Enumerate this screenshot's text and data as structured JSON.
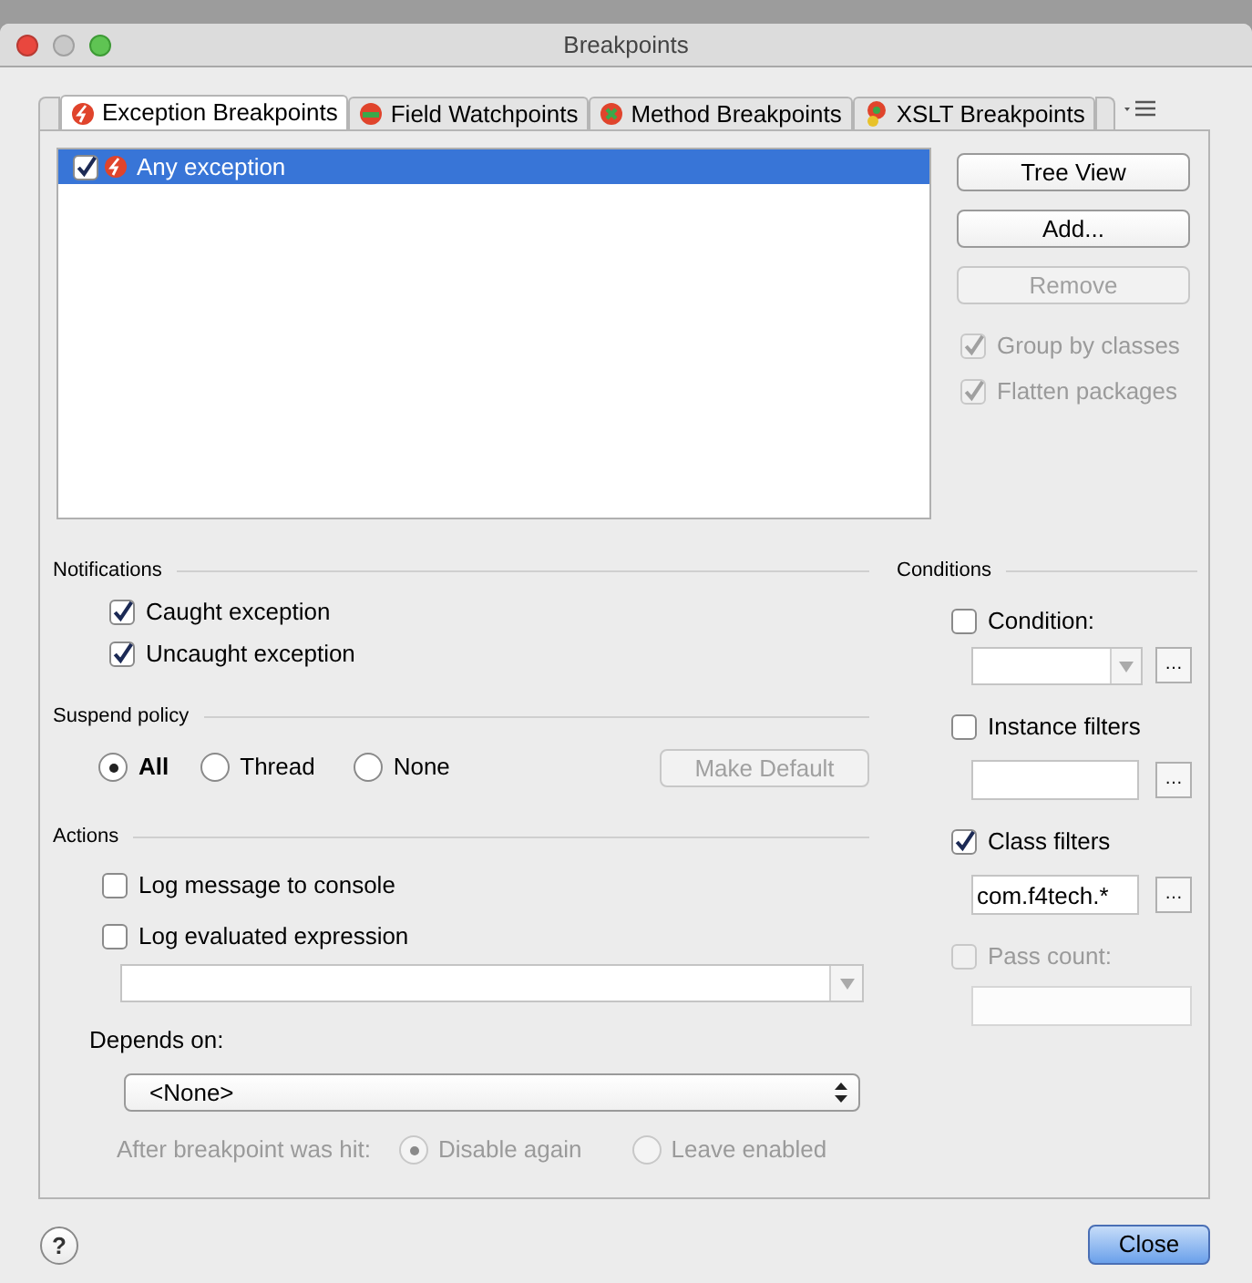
{
  "window": {
    "title": "Breakpoints"
  },
  "tabs": [
    {
      "label": "Exception Breakpoints",
      "selected": true,
      "kind": "exception"
    },
    {
      "label": "Field Watchpoints",
      "selected": false,
      "kind": "field"
    },
    {
      "label": "Method Breakpoints",
      "selected": false,
      "kind": "method"
    },
    {
      "label": "XSLT Breakpoints",
      "selected": false,
      "kind": "xslt"
    }
  ],
  "breakpoint_list": [
    {
      "label": "Any exception",
      "checked": true,
      "selected": true
    }
  ],
  "side_buttons": [
    {
      "label": "Tree View",
      "disabled": false
    },
    {
      "label": "Add...",
      "disabled": false
    },
    {
      "label": "Remove",
      "disabled": true
    }
  ],
  "side_options": [
    {
      "label": "Group by classes",
      "checked": true,
      "disabled": true
    },
    {
      "label": "Flatten packages",
      "checked": true,
      "disabled": true
    }
  ],
  "notifications": {
    "title": "Notifications",
    "options": [
      {
        "label": "Caught exception",
        "checked": true
      },
      {
        "label": "Uncaught exception",
        "checked": true
      }
    ]
  },
  "suspend_policy": {
    "title": "Suspend policy",
    "options": [
      {
        "label": "All",
        "selected": true
      },
      {
        "label": "Thread",
        "selected": false
      },
      {
        "label": "None",
        "selected": false
      }
    ],
    "make_default": {
      "label": "Make Default",
      "disabled": true
    }
  },
  "actions": {
    "title": "Actions",
    "log_message": {
      "label": "Log message to console",
      "checked": false
    },
    "log_expression": {
      "label": "Log evaluated expression",
      "checked": false
    },
    "depends_on": {
      "label": "Depends on:",
      "value": "<None>"
    },
    "after_hit": {
      "label": "After breakpoint was hit:",
      "disabled": true,
      "options": [
        {
          "label": "Disable again",
          "selected": true
        },
        {
          "label": "Leave enabled",
          "selected": false
        }
      ]
    }
  },
  "conditions": {
    "title": "Conditions",
    "condition": {
      "label": "Condition:",
      "checked": false,
      "browse_label": "…"
    },
    "instance_filters": {
      "label": "Instance filters",
      "checked": false,
      "browse_label": "…"
    },
    "class_filters": {
      "label": "Class filters",
      "checked": true,
      "value": "com.f4tech.*",
      "browse_label": "…"
    },
    "pass_count": {
      "label": "Pass count:",
      "checked": false,
      "disabled": true
    }
  },
  "help_button": {
    "label": "?"
  },
  "close_button": {
    "label": "Close"
  }
}
